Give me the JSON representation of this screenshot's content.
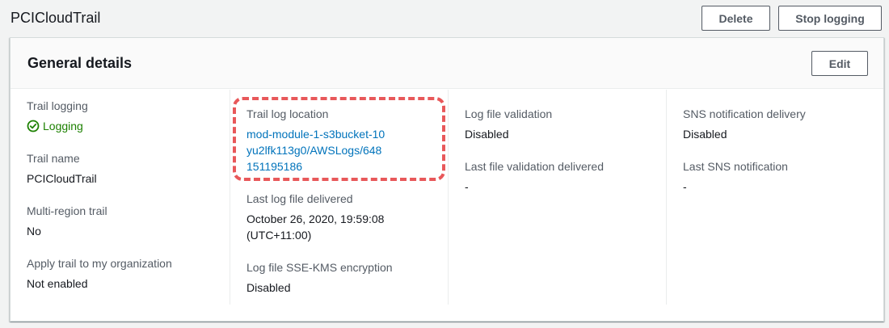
{
  "page": {
    "title": "PCICloudTrail",
    "delete_label": "Delete",
    "stop_logging_label": "Stop logging"
  },
  "general": {
    "title": "General details",
    "edit_label": "Edit"
  },
  "col1": {
    "trail_logging_label": "Trail logging",
    "trail_logging_value": "Logging",
    "trail_name_label": "Trail name",
    "trail_name_value": "PCICloudTrail",
    "multi_region_label": "Multi-region trail",
    "multi_region_value": "No",
    "apply_org_label": "Apply trail to my organization",
    "apply_org_value": "Not enabled"
  },
  "col2": {
    "log_location_label": "Trail log location",
    "log_location_value": "mod-module-1-s3bucket-10yu2lfk113g0/AWSLogs/648151195186",
    "last_log_label": "Last log file delivered",
    "last_log_value": "October 26, 2020, 19:59:08 (UTC+11:00)",
    "sse_label": "Log file SSE-KMS encryption",
    "sse_value": "Disabled"
  },
  "col3": {
    "validation_label": "Log file validation",
    "validation_value": "Disabled",
    "last_validation_label": "Last file validation delivered",
    "last_validation_value": "-"
  },
  "col4": {
    "sns_label": "SNS notification delivery",
    "sns_value": "Disabled",
    "last_sns_label": "Last SNS notification",
    "last_sns_value": "-"
  },
  "colors": {
    "link": "#0073bb",
    "success": "#1d8102",
    "highlight": "#e8585a"
  },
  "icons": {
    "status": "check-circle-icon"
  }
}
